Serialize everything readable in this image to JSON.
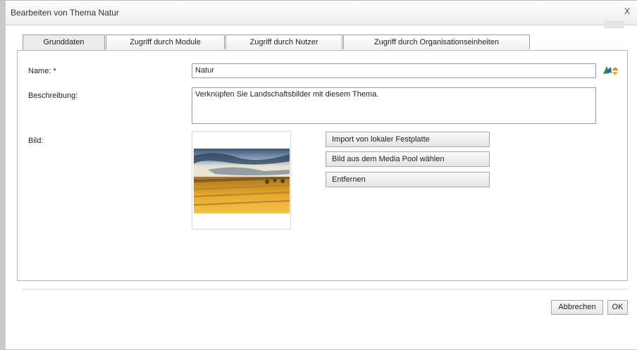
{
  "dialog": {
    "title": "Bearbeiten von Thema Natur",
    "close_label": "X"
  },
  "tabs": [
    {
      "label": "Grunddaten"
    },
    {
      "label": "Zugriff durch Module"
    },
    {
      "label": "Zugriff durch Nutzer"
    },
    {
      "label": "Zugriff durch Organisationseinheiten"
    }
  ],
  "form": {
    "name_label": "Name: *",
    "name_value": "Natur",
    "description_label": "Beschreibung:",
    "description_value": "Verknüpfen Sie Landschaftsbilder mit diesem Thema.",
    "image_label": "Bild:"
  },
  "image_actions": {
    "import_label": "Import von lokaler Festplatte",
    "media_pool_label": "Bild aus dem Media Pool wählen",
    "remove_label": "Entfernen"
  },
  "footer": {
    "cancel_label": "Abbrechen",
    "ok_label": "OK"
  },
  "icons": {
    "translate": "translate-icon",
    "close": "close-icon"
  },
  "colors": {
    "border": "#b5b5b5",
    "tab_active": "#ececec",
    "button_top": "#fafafa",
    "button_bottom": "#e4e4e4"
  }
}
